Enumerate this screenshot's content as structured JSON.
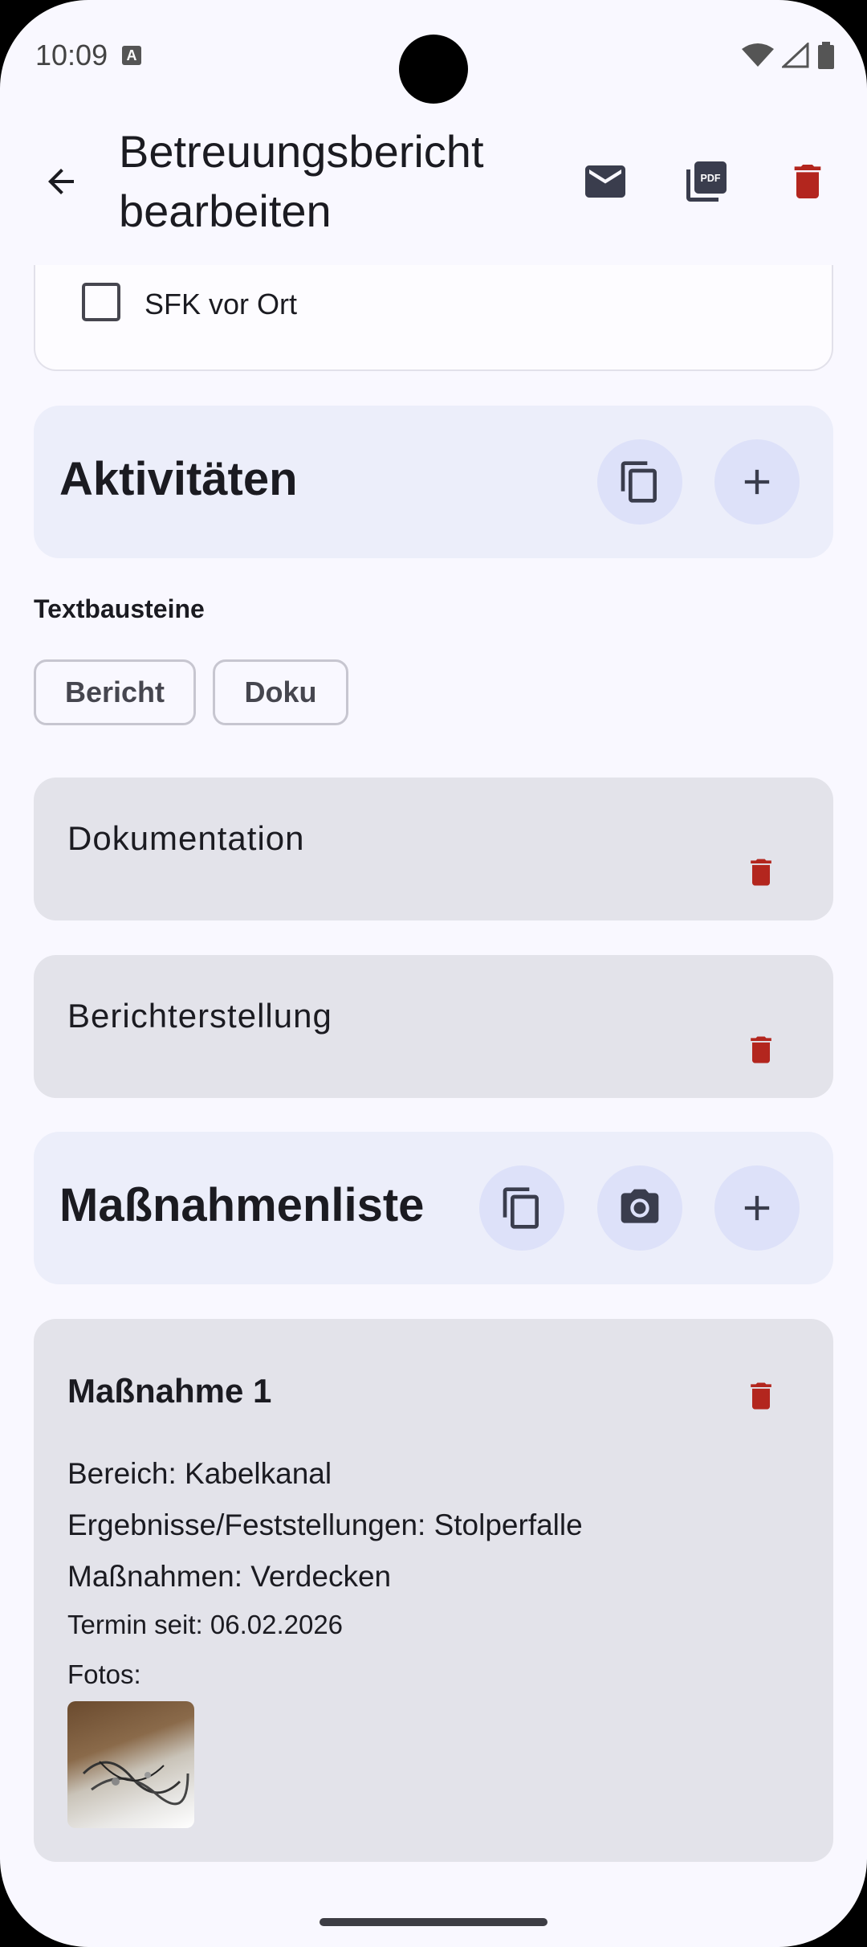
{
  "status": {
    "time": "10:09",
    "a_badge": "A"
  },
  "appbar": {
    "title": "Betreuungsbericht bearbeiten"
  },
  "top_card": {
    "checkbox_label": "SFK vor Ort",
    "checked": false
  },
  "activities": {
    "title": "Aktivitäten",
    "textbausteine_label": "Textbausteine",
    "chips": [
      "Bericht",
      "Doku"
    ],
    "items": [
      "Dokumentation",
      "Berichterstellung"
    ]
  },
  "measures": {
    "title": "Maßnahmenliste",
    "item": {
      "title": "Maßnahme 1",
      "bereich": "Bereich: Kabelkanal",
      "ergebnisse": "Ergebnisse/Feststellungen: Stolperfalle",
      "massnahmen": "Maßnahmen: Verdecken",
      "termin": "Termin seit: 06.02.2026",
      "fotos_label": "Fotos:"
    }
  },
  "colors": {
    "accent": "#dde1f9",
    "delete": "#b3261e",
    "surface": "#f9f8ff"
  },
  "icons": [
    "back-arrow-icon",
    "mail-icon",
    "pdf-icon",
    "delete-icon",
    "copy-icon",
    "add-icon",
    "camera-icon"
  ]
}
